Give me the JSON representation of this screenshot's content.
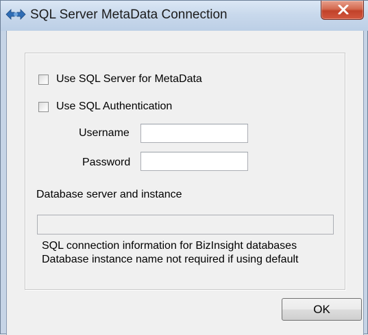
{
  "window": {
    "title": "SQL Server MetaData Connection",
    "icon": "sql-server-connection-icon",
    "close_icon": "close-icon",
    "close_color": "#c7452c"
  },
  "form": {
    "use_sql_server_label": "Use SQL Server for MetaData",
    "use_sql_server_checked": false,
    "use_sql_auth_label": "Use SQL Authentication",
    "use_sql_auth_checked": false,
    "username_label": "Username",
    "username_value": "",
    "password_label": "Password",
    "password_value": "",
    "server_label": "Database server and instance",
    "server_value": "",
    "help_line1": "SQL connection information for BizInsight databases",
    "help_line2": "Database instance name not required if using default"
  },
  "buttons": {
    "ok_label": "OK"
  }
}
